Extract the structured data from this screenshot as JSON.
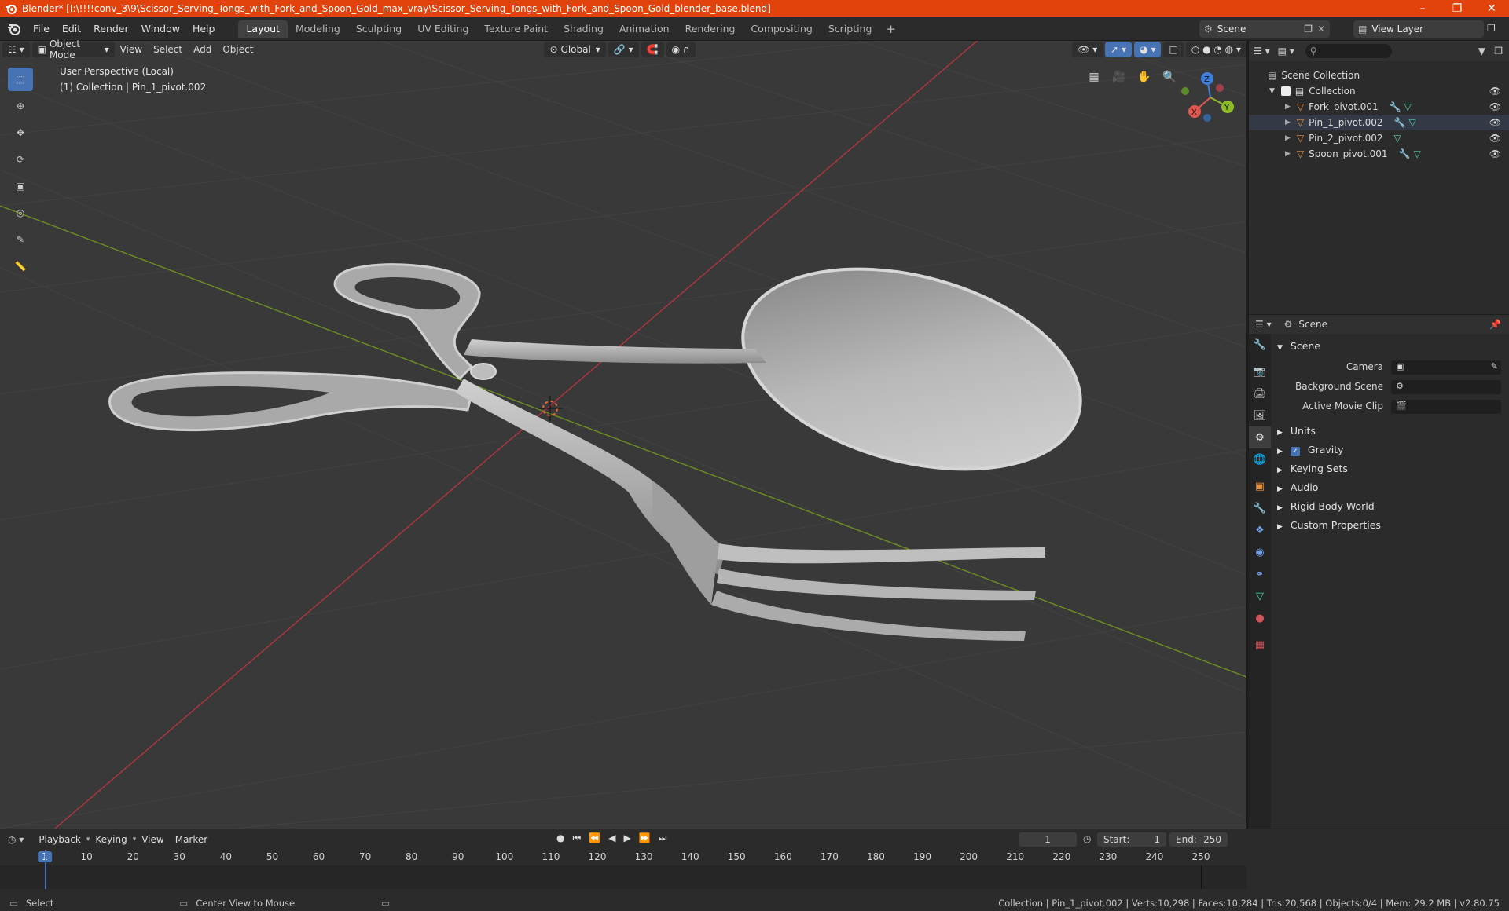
{
  "window": {
    "title": "Blender* [I:\\!!!!conv_3\\9\\Scissor_Serving_Tongs_with_Fork_and_Spoon_Gold_max_vray\\Scissor_Serving_Tongs_with_Fork_and_Spoon_Gold_blender_base.blend]",
    "minimize": "–",
    "restore": "❐",
    "close": "✕"
  },
  "menu": [
    "File",
    "Edit",
    "Render",
    "Window",
    "Help"
  ],
  "workspaces": [
    "Layout",
    "Modeling",
    "Sculpting",
    "UV Editing",
    "Texture Paint",
    "Shading",
    "Animation",
    "Rendering",
    "Compositing",
    "Scripting"
  ],
  "workspace_add": "+",
  "scene_name": "Scene",
  "view_layer": "View Layer",
  "viewport": {
    "mode": "Object Mode",
    "menus": [
      "View",
      "Select",
      "Add",
      "Object"
    ],
    "transform_orientation": "Global",
    "info_line1": "User Perspective (Local)",
    "info_line2": "(1) Collection | Pin_1_pivot.002",
    "gizmo": {
      "x": "X",
      "y": "Y",
      "z": "Z"
    }
  },
  "outliner": {
    "root": "Scene Collection",
    "collection": "Collection",
    "objects": [
      "Fork_pivot.001",
      "Pin_1_pivot.002",
      "Pin_2_pivot.002",
      "Spoon_pivot.001"
    ]
  },
  "properties": {
    "header_title": "Scene",
    "panel_title": "Scene",
    "fields": [
      "Camera",
      "Background Scene",
      "Active Movie Clip"
    ],
    "sections": [
      "Units",
      "Gravity",
      "Keying Sets",
      "Audio",
      "Rigid Body World",
      "Custom Properties"
    ]
  },
  "timeline": {
    "menus": [
      "Playback",
      "Keying",
      "View",
      "Marker"
    ],
    "current_frame": "1",
    "start_label": "Start:",
    "start": "1",
    "end_label": "End:",
    "end": "250",
    "ticks": [
      "1",
      "10",
      "20",
      "30",
      "40",
      "50",
      "60",
      "70",
      "80",
      "90",
      "100",
      "110",
      "120",
      "130",
      "140",
      "150",
      "160",
      "170",
      "180",
      "190",
      "200",
      "210",
      "220",
      "230",
      "240",
      "250"
    ]
  },
  "status": {
    "left": "Select",
    "middle": "Center View to Mouse",
    "right": "Collection | Pin_1_pivot.002 | Verts:10,298 | Faces:10,284 | Tris:20,568 | Objects:0/4 | Mem: 29.2 MB | v2.80.75"
  },
  "colors": {
    "titlebar": "#e2420c",
    "accent": "#4772b3",
    "viewport_bg": "#393939",
    "x_axis": "#e0584f",
    "y_axis": "#8dbb28",
    "z_axis": "#3f7fe0",
    "object_orange": "#e8903a"
  }
}
